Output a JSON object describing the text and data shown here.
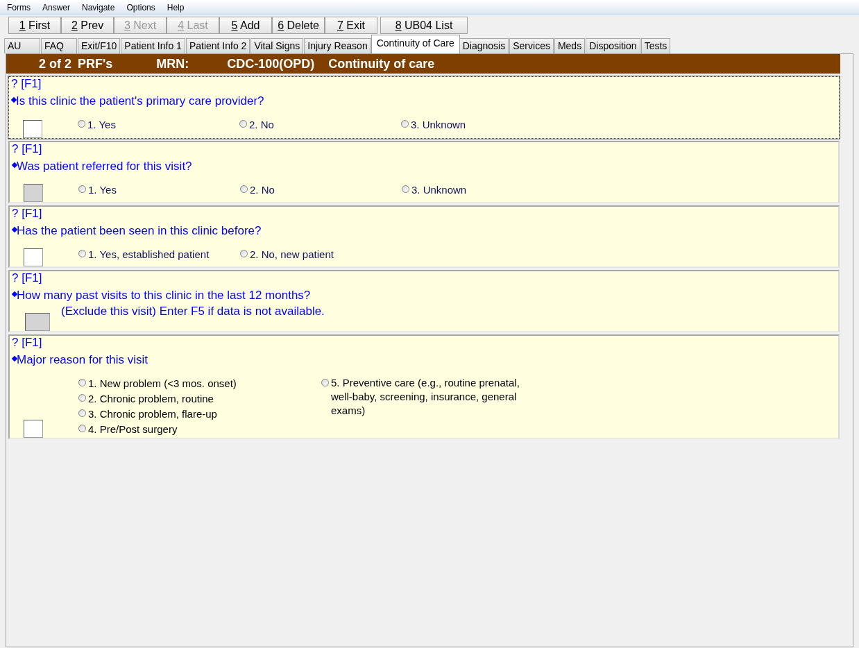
{
  "menu": [
    "Forms",
    "Answer",
    "Navigate",
    "Options",
    "Help"
  ],
  "toolbar": [
    {
      "hotkey": "1",
      "label": " First",
      "disabled": false
    },
    {
      "hotkey": "2",
      "label": " Prev",
      "disabled": false
    },
    {
      "hotkey": "3",
      "label": " Next",
      "disabled": true
    },
    {
      "hotkey": "4",
      "label": " Last",
      "disabled": true
    },
    {
      "hotkey": "5",
      "label": " Add",
      "disabled": false
    },
    {
      "hotkey": "6",
      "label": " Delete",
      "disabled": false
    },
    {
      "hotkey": "7",
      "label": " Exit",
      "disabled": false
    },
    {
      "hotkey": "8",
      "label": " UB04 List",
      "disabled": false
    }
  ],
  "tabs": [
    {
      "label": "AU",
      "selected": false
    },
    {
      "label": "FAQ",
      "selected": false
    },
    {
      "label": "Exit/F10",
      "selected": false
    },
    {
      "label": "Patient Info 1",
      "selected": false
    },
    {
      "label": "Patient Info 2",
      "selected": false
    },
    {
      "label": "Vital Signs",
      "selected": false
    },
    {
      "label": "Injury Reason",
      "selected": false
    },
    {
      "label": "Continuity of Care",
      "selected": true
    },
    {
      "label": "Diagnosis",
      "selected": false
    },
    {
      "label": "Services",
      "selected": false
    },
    {
      "label": "Meds",
      "selected": false
    },
    {
      "label": "Disposition",
      "selected": false
    },
    {
      "label": "Tests",
      "selected": false
    }
  ],
  "header": {
    "record": "2 of 2",
    "form": "PRF's",
    "mrn_label": "MRN:",
    "mrn": "CDC-100(OPD)",
    "section": "Continuity of care"
  },
  "questions": [
    {
      "kind": "row",
      "help": "? [F1]",
      "text": "Is this clinic the patient's primary care provider?",
      "focused": true,
      "input_disabled": false,
      "options": [
        {
          "label": "1. Yes",
          "selected": false
        },
        {
          "label": "2. No",
          "selected": false
        },
        {
          "label": "3. Unknown",
          "selected": false
        }
      ]
    },
    {
      "kind": "row",
      "help": "? [F1]",
      "text": "Was patient referred for this visit?",
      "focused": false,
      "input_disabled": true,
      "options": [
        {
          "label": "1. Yes",
          "selected": false
        },
        {
          "label": "2. No",
          "selected": false
        },
        {
          "label": "3. Unknown",
          "selected": false
        }
      ]
    },
    {
      "kind": "row",
      "help": "? [F1]",
      "text": "Has the patient been seen in this clinic before?",
      "focused": false,
      "input_disabled": false,
      "options": [
        {
          "label": "1. Yes, established patient",
          "selected": false
        },
        {
          "label": "2. No, new patient",
          "selected": false
        }
      ]
    },
    {
      "kind": "note",
      "help": "? [F1]",
      "text": "How many past visits to this clinic in the last 12 months?",
      "note": "(Exclude this visit) Enter F5 if data is not available.",
      "focused": false,
      "input_disabled": true
    },
    {
      "kind": "columns",
      "help": "? [F1]",
      "text": "Major reason for this visit",
      "focused": false,
      "input_disabled": false,
      "column_1": [
        {
          "label": "1. New problem (<3 mos. onset)",
          "selected": false
        },
        {
          "label": "2. Chronic problem, routine",
          "selected": false
        },
        {
          "label": "3. Chronic problem, flare-up",
          "selected": false
        },
        {
          "label": "4. Pre/Post surgery",
          "selected": false
        }
      ],
      "column_2": [
        {
          "label": "5. Preventive care (e.g., routine prenatal, well-baby, screening, insurance, general exams)",
          "selected": false
        }
      ]
    }
  ]
}
